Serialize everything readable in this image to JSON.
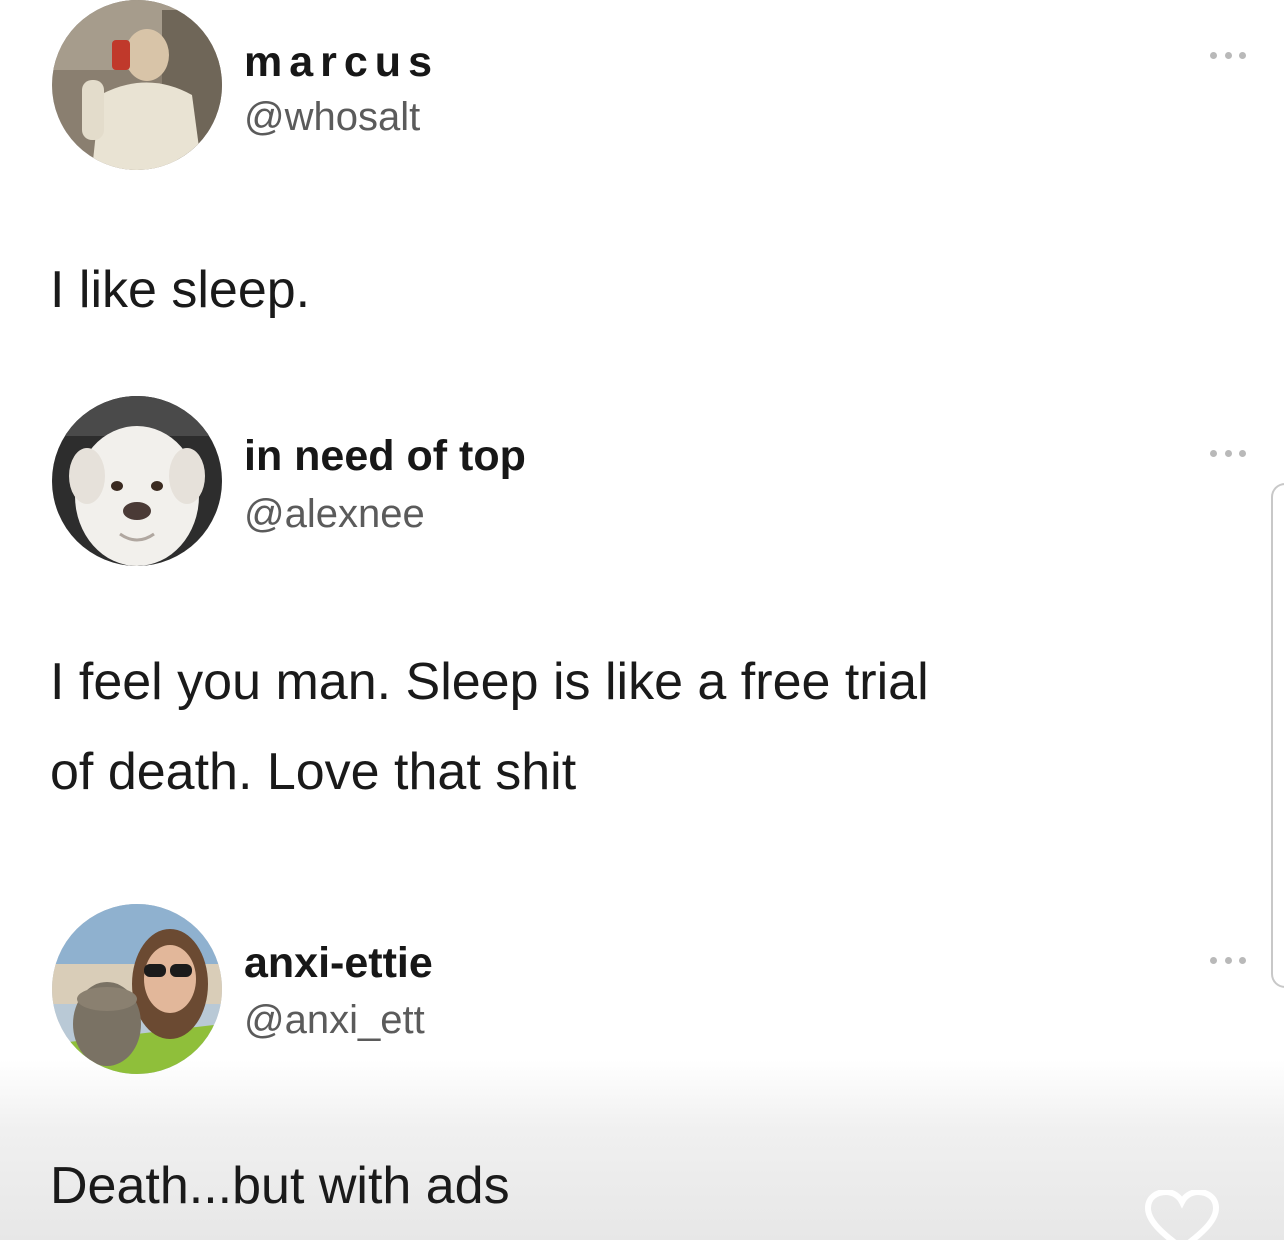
{
  "tweets": [
    {
      "display_name": "marcus",
      "handle": "@whosalt",
      "text": "I like sleep.",
      "avatar_icon": "avatar-photo-person-mirror-selfie"
    },
    {
      "display_name": "in need of top",
      "handle": "@alexnee",
      "text_line1": "I feel you man. Sleep is like a free trial",
      "text_line2": "of death. Love that shit",
      "avatar_icon": "avatar-photo-white-dog"
    },
    {
      "display_name": "anxi-ettie",
      "handle": "@anxi_ett",
      "text": "Death...but with ads",
      "avatar_icon": "avatar-photo-woman-with-cat"
    }
  ],
  "icons": {
    "more": "more-options-icon",
    "like": "heart-icon"
  },
  "colors": {
    "background": "#ffffff",
    "text": "#1a1a1a",
    "handle": "#5b5b5b"
  }
}
